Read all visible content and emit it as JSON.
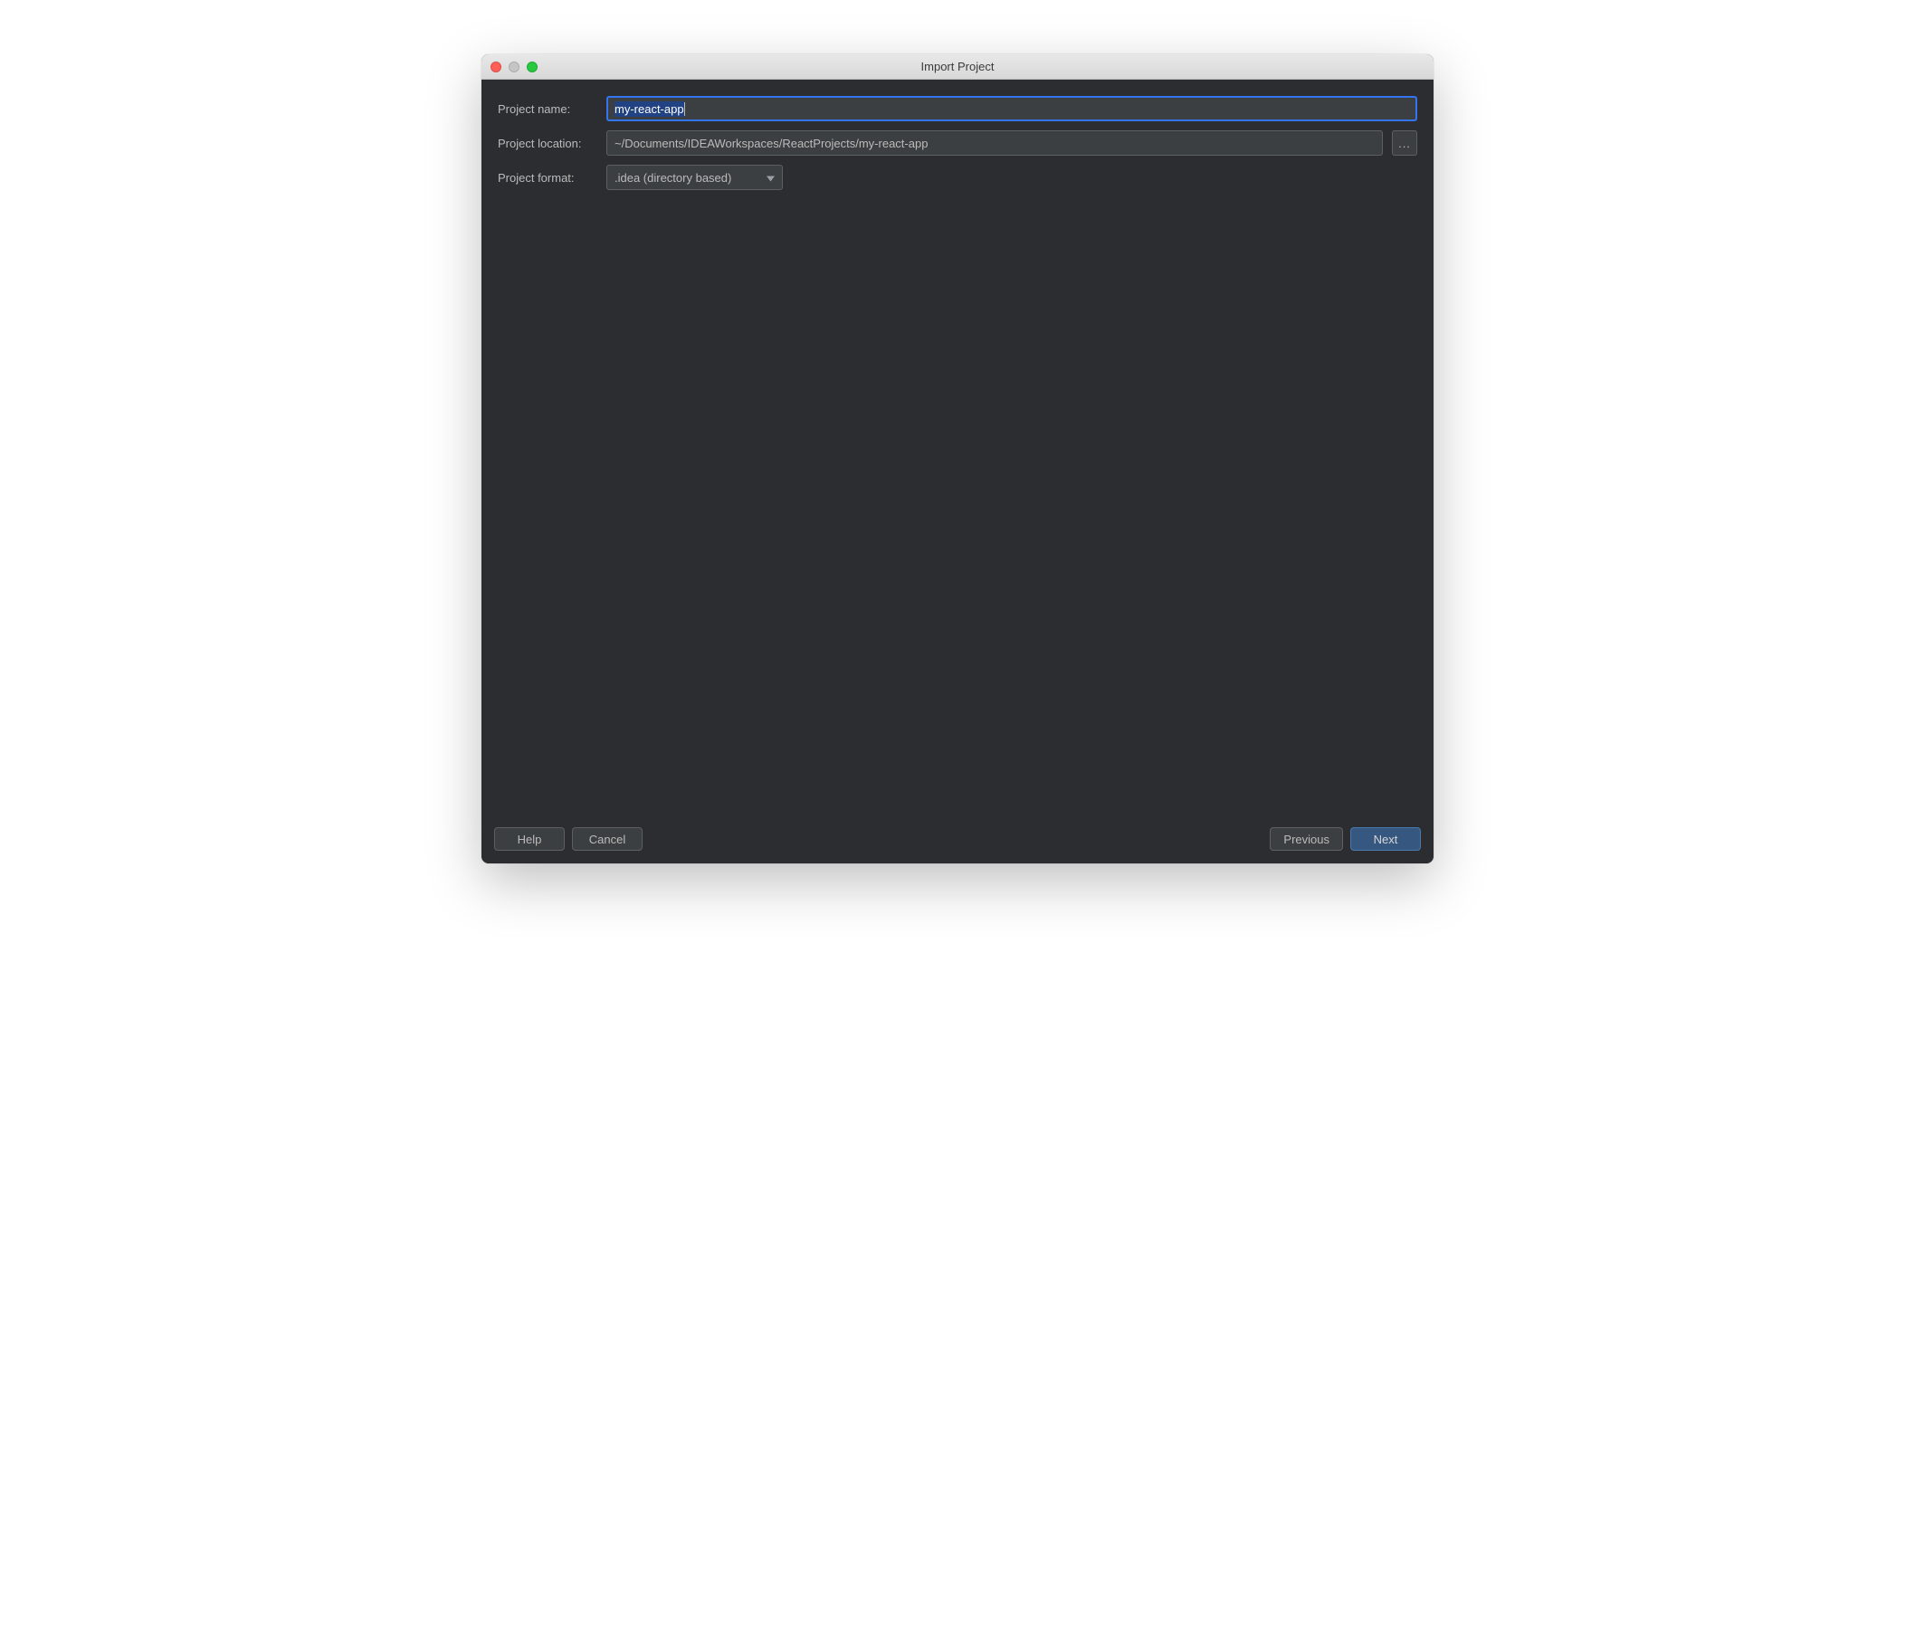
{
  "window": {
    "title": "Import Project"
  },
  "form": {
    "projectName": {
      "label": "Project name:",
      "value": "my-react-app"
    },
    "projectLocation": {
      "label": "Project location:",
      "value": "~/Documents/IDEAWorkspaces/ReactProjects/my-react-app",
      "browseLabel": "..."
    },
    "projectFormat": {
      "label": "Project format:",
      "selected": ".idea (directory based)"
    }
  },
  "footer": {
    "help": "Help",
    "cancel": "Cancel",
    "previous": "Previous",
    "next": "Next"
  }
}
